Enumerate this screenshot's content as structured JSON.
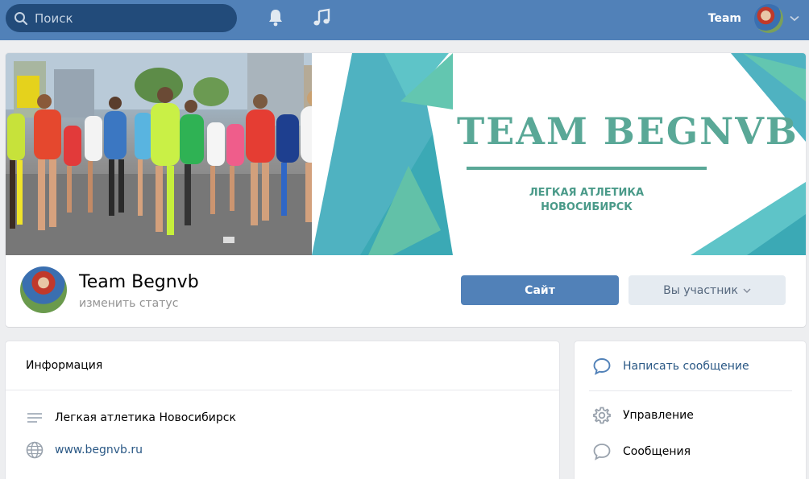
{
  "header": {
    "search_placeholder": "Поиск",
    "user_name": "Team"
  },
  "colors": {
    "header_bg": "#5181b8",
    "search_bg": "#224b7a",
    "primary_button": "#5181b8",
    "secondary_button": "#e5ebf1",
    "link": "#2a5885",
    "banner_accent": "#5aa897"
  },
  "cover": {
    "banner_title": "TEAM BEGNVB",
    "banner_subtitle_line1": "ЛЕГКАЯ АТЛЕТИКА",
    "banner_subtitle_line2": "НОВОСИБИРСК"
  },
  "group": {
    "name": "Team Begnvb",
    "status": "изменить статус",
    "site_button": "Сайт",
    "member_button": "Вы участник"
  },
  "info": {
    "title": "Информация",
    "description": "Легкая атлетика Новосибирск",
    "website": "www.begnvb.ru"
  },
  "side_menu": {
    "write_message": "Написать сообщение",
    "manage": "Управление",
    "messages": "Сообщения"
  }
}
